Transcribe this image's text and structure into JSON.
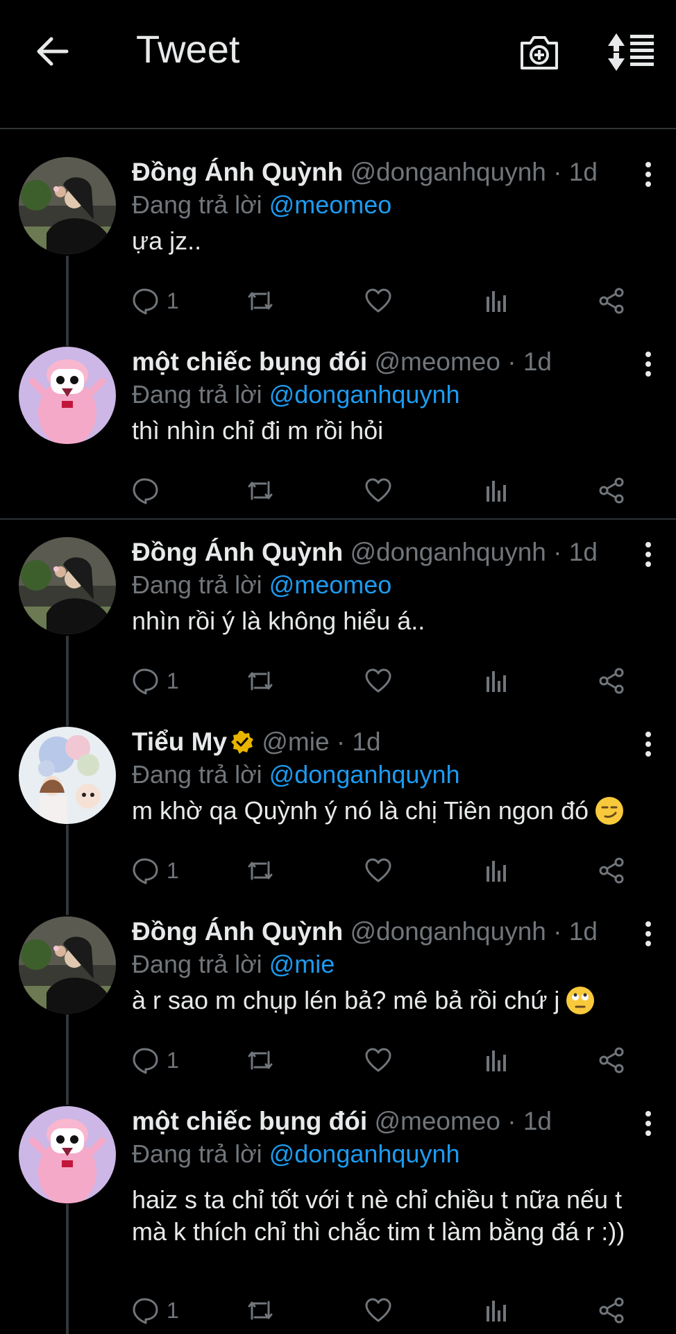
{
  "header": {
    "title": "Tweet",
    "back_icon": "arrow-left-icon",
    "camera_icon": "camera-plus-icon",
    "sort_icon": "sort-icon"
  },
  "colors": {
    "background": "#000000",
    "accent": "#1d9bf0",
    "muted": "#71767b",
    "verified": "#e8b400"
  },
  "tweets": [
    {
      "name": "Đồng Ánh Quỳnh",
      "handle": "@donganhquynh · 1d",
      "reply_prefix": "Đang trả lời",
      "reply_to": "@meomeo",
      "text": "ựa jz..",
      "reply_count": "1"
    },
    {
      "name": "một chiếc bụng đói",
      "handle": "@meomeo · 1d",
      "reply_prefix": "Đang trả lời",
      "reply_to": "@donganhquynh",
      "text": "thì nhìn chỉ đi m rồi hỏi",
      "reply_count": ""
    },
    {
      "name": "Đồng Ánh Quỳnh",
      "handle": "@donganhquynh · 1d",
      "reply_prefix": "Đang trả lời",
      "reply_to": "@meomeo",
      "text": "nhìn rồi ý là không hiểu á..",
      "reply_count": "1"
    },
    {
      "name": "Tiểu My",
      "handle": "@mie · 1d",
      "reply_prefix": "Đang trả lời",
      "reply_to": "@donganhquynh",
      "text": "m khờ qa Quỳnh ý nó là chị Tiên ngon đó",
      "reply_count": "1"
    },
    {
      "name": "Đồng Ánh Quỳnh",
      "handle": "@donganhquynh · 1d",
      "reply_prefix": "Đang trả lời",
      "reply_to": "@mie",
      "text": "à r sao m chụp lén bả? mê bả rồi chứ j",
      "reply_count": "1"
    },
    {
      "name": "một chiếc bụng đói",
      "handle": "@meomeo · 1d",
      "reply_prefix": "Đang trả lời",
      "reply_to": "@donganhquynh",
      "text": "haiz s ta chỉ tốt với t nè chỉ chiều t nữa nếu t mà k thích chỉ thì chắc tim t làm bằng đá r :))",
      "reply_count": "1"
    }
  ]
}
